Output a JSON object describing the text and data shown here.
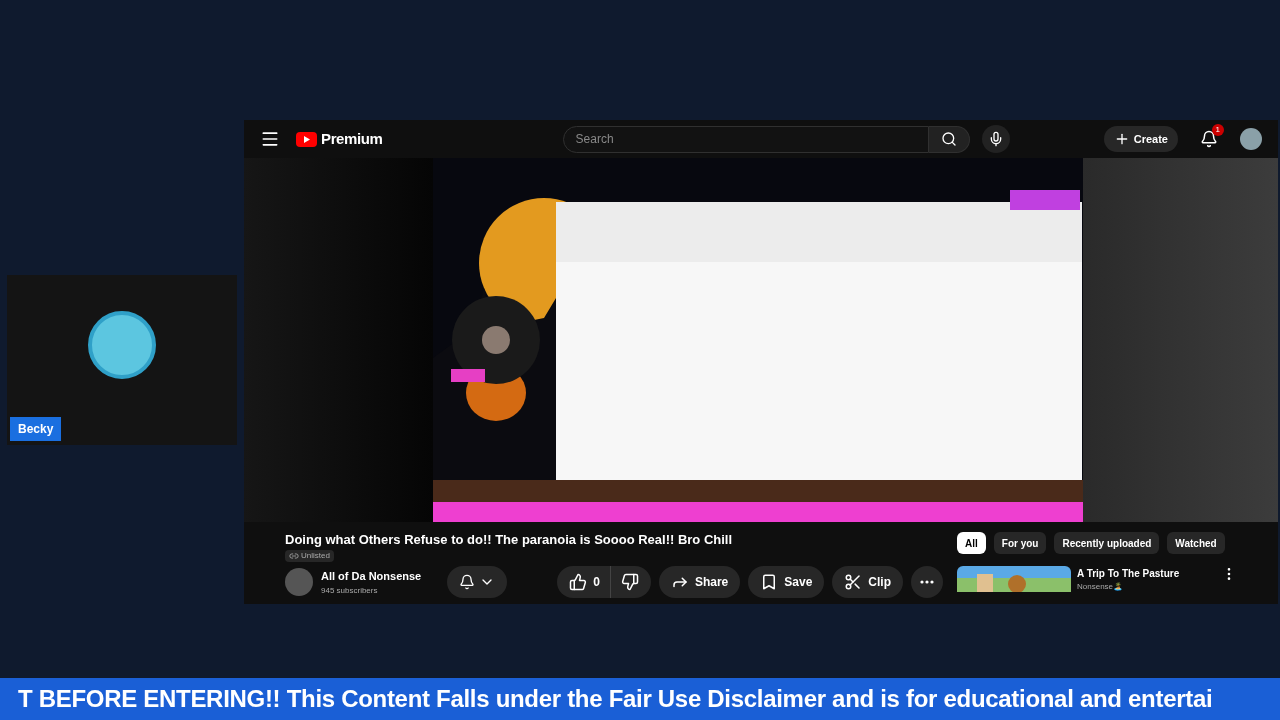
{
  "guest_card": {
    "name": "Becky"
  },
  "youtube": {
    "brand": "Premium",
    "search": {
      "placeholder": "Search"
    },
    "create_label": "Create",
    "notification_count": "1",
    "video": {
      "title": "Doing what Others Refuse to do!! The paranoia is Soooo Real!! Bro Chill",
      "visibility": "Unlisted"
    },
    "channel": {
      "name": "All of Da Nonsense",
      "subscribers": "945 subscribers"
    },
    "actions": [
      {
        "kind": "like",
        "label": "0"
      },
      {
        "kind": "dislike"
      },
      {
        "kind": "share",
        "label": "Share"
      },
      {
        "kind": "save",
        "label": "Save"
      },
      {
        "kind": "clip",
        "label": "Clip"
      },
      {
        "kind": "more"
      }
    ],
    "chips": [
      {
        "label": "All",
        "selected": true
      },
      {
        "label": "For you",
        "selected": false
      },
      {
        "label": "Recently uploaded",
        "selected": false
      },
      {
        "label": "Watched",
        "selected": false
      }
    ],
    "recommendation": {
      "title": "A Trip To The Pasture",
      "channel": "Nonsense🏝️"
    }
  },
  "ticker": {
    "text": "T BEFORE ENTERING!! This Content Falls under the Fair Use Disclaimer and is for educational and entertai"
  }
}
